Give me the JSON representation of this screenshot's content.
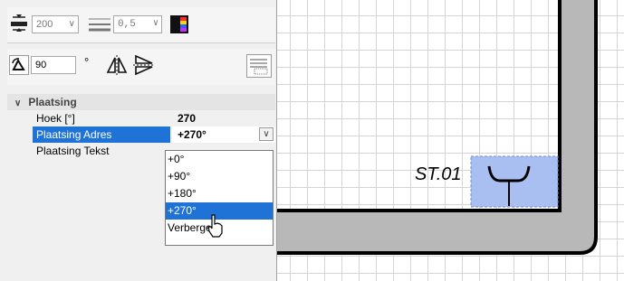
{
  "toolbar": {
    "line_width": "200",
    "line_style_value": "0,5",
    "rotation_value": "90",
    "degree_symbol": "°"
  },
  "property_grid": {
    "category": "Plaatsing",
    "rows": [
      {
        "label": "Hoek [°]",
        "value": "270"
      },
      {
        "label": "Plaatsing Adres",
        "value": "+270°"
      },
      {
        "label": "Plaatsing Tekst",
        "value": ""
      }
    ]
  },
  "dropdown": {
    "options": [
      "+0°",
      "+90°",
      "+180°",
      "+270°",
      "Verbergen"
    ],
    "highlighted": "+270°"
  },
  "canvas": {
    "symbol_label": "ST.01"
  },
  "colors": {
    "selection": "#1f73d6",
    "wall": "#b8b8b8",
    "symbol_highlight": "#a9bff2"
  }
}
